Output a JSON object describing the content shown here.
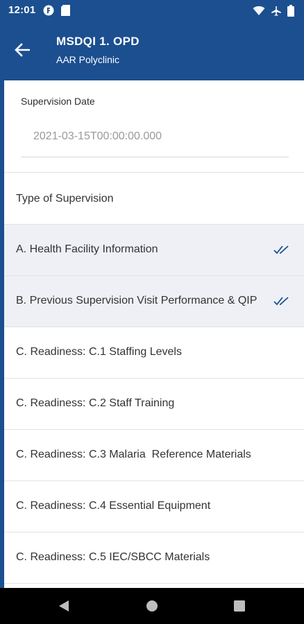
{
  "status_bar": {
    "time": "12:01",
    "icons": [
      "notification-app-icon",
      "sd-card-icon",
      "wifi-icon",
      "airplane-icon",
      "battery-icon"
    ]
  },
  "app_bar": {
    "title": "MSDQI 1. OPD",
    "subtitle": "AAR Polyclinic",
    "back_icon": "arrow-back-icon"
  },
  "form": {
    "date_label": "Supervision Date",
    "date_value": "2021-03-15T00:00:00.000",
    "type_label": "Type of Supervision"
  },
  "sections": [
    {
      "label": "A. Health Facility Information",
      "completed": true
    },
    {
      "label": "B. Previous Supervision Visit Performance & QIP",
      "completed": true
    },
    {
      "label": "C. Readiness: C.1 Staffing Levels",
      "completed": false
    },
    {
      "label": "C. Readiness: C.2 Staff Training",
      "completed": false
    },
    {
      "label": "C. Readiness: C.3 Malaria  Reference Materials",
      "completed": false
    },
    {
      "label": "C. Readiness: C.4 Essential Equipment",
      "completed": false
    },
    {
      "label": "C. Readiness: C.5 IEC/SBCC Materials",
      "completed": false
    }
  ],
  "nav_bar": {
    "icons": [
      "nav-back-icon",
      "nav-home-icon",
      "nav-recents-icon"
    ]
  },
  "colors": {
    "primary": "#1b4f8f",
    "completed_row_bg": "#eef0f5",
    "check": "#1b4f8f",
    "nav_bar": "#000000"
  }
}
